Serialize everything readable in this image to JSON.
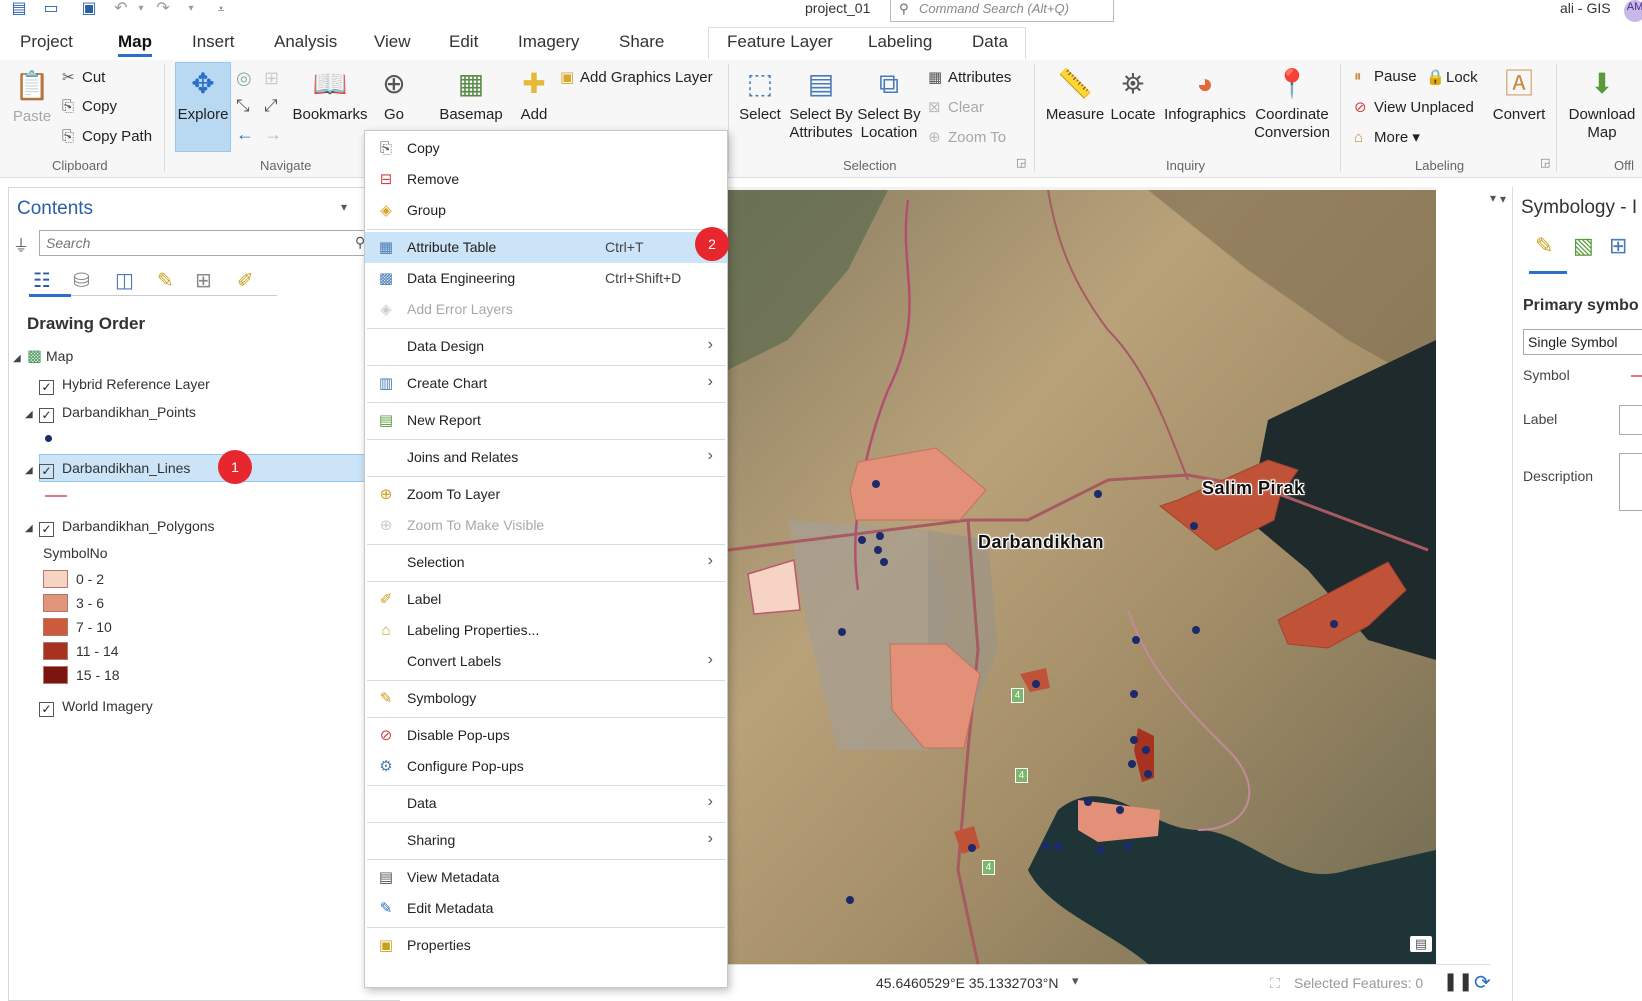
{
  "titlebar": {
    "document": "project_01",
    "search_placeholder": "Command Search (Alt+Q)",
    "user": "ali - GIS",
    "avatar_initials": "AM"
  },
  "tabs": {
    "main": [
      "Project",
      "Map",
      "Insert",
      "Analysis",
      "View",
      "Edit",
      "Imagery",
      "Share"
    ],
    "active": "Map",
    "contextual": [
      "Feature Layer",
      "Labeling",
      "Data"
    ]
  },
  "ribbon": {
    "clipboard": {
      "paste": "Paste",
      "cut": "Cut",
      "copy": "Copy",
      "copy_path": "Copy Path",
      "label": "Clipboard"
    },
    "navigate": {
      "explore": "Explore",
      "bookmarks": "Bookmarks",
      "go": "Go",
      "label": "Navigate"
    },
    "layer": {
      "basemap": "Basemap",
      "add": "Add",
      "add_graphics": "Add Graphics Layer"
    },
    "selection": {
      "select": "Select",
      "select_by_attributes": "Select By Attributes",
      "select_by_location": "Select By Location",
      "attributes": "Attributes",
      "clear": "Clear",
      "zoom_to": "Zoom To",
      "label": "Selection"
    },
    "inquiry": {
      "measure": "Measure",
      "locate": "Locate",
      "infographics": "Infographics",
      "coordinate": "Coordinate Conversion",
      "label": "Inquiry"
    },
    "labeling": {
      "pause": "Pause",
      "lock": "Lock",
      "view_unplaced": "View Unplaced",
      "more": "More",
      "convert": "Convert",
      "label": "Labeling"
    },
    "offline": {
      "download": "Download Map",
      "label": "Offl"
    }
  },
  "contents": {
    "title": "Contents",
    "search_placeholder": "Search",
    "section": "Drawing Order",
    "map": "Map",
    "layers": {
      "hybrid": "Hybrid Reference Layer",
      "points": "Darbandikhan_Points",
      "lines": "Darbandikhan_Lines",
      "polygons": "Darbandikhan_Polygons",
      "world": "World Imagery"
    },
    "legend_field": "SymbolNo",
    "legend": [
      {
        "label": "0 - 2",
        "color": "#f6d3c2"
      },
      {
        "label": "3 - 6",
        "color": "#e3957b"
      },
      {
        "label": "7 - 10",
        "color": "#cc5a3c"
      },
      {
        "label": "11 - 14",
        "color": "#a7321f"
      },
      {
        "label": "15 - 18",
        "color": "#7c1510"
      }
    ],
    "badge1": "1"
  },
  "menu": {
    "copy": "Copy",
    "remove": "Remove",
    "group": "Group",
    "attribute_table": "Attribute Table",
    "attribute_table_sc": "Ctrl+T",
    "data_engineering": "Data Engineering",
    "data_engineering_sc": "Ctrl+Shift+D",
    "add_error_layers": "Add Error Layers",
    "data_design": "Data Design",
    "create_chart": "Create Chart",
    "new_report": "New Report",
    "joins_relates": "Joins and Relates",
    "zoom_to_layer": "Zoom To Layer",
    "zoom_visible": "Zoom To Make Visible",
    "selection": "Selection",
    "label": "Label",
    "labeling_props": "Labeling Properties...",
    "convert_labels": "Convert Labels",
    "symbology": "Symbology",
    "disable_popups": "Disable Pop-ups",
    "configure_popups": "Configure Pop-ups",
    "data": "Data",
    "sharing": "Sharing",
    "view_metadata": "View Metadata",
    "edit_metadata": "Edit Metadata",
    "properties": "Properties",
    "badge2": "2"
  },
  "map": {
    "labels": {
      "salim": "Salim Pirak",
      "darband": "Darbandikhan"
    },
    "road_shield": "4",
    "coordinates": "45.6460529°E 35.1332703°N",
    "selected": "Selected Features: 0"
  },
  "symbology": {
    "title": "Symbology - I",
    "primary": "Primary symbo",
    "type": "Single Symbol",
    "symbol": "Symbol",
    "label": "Label",
    "description": "Description"
  }
}
